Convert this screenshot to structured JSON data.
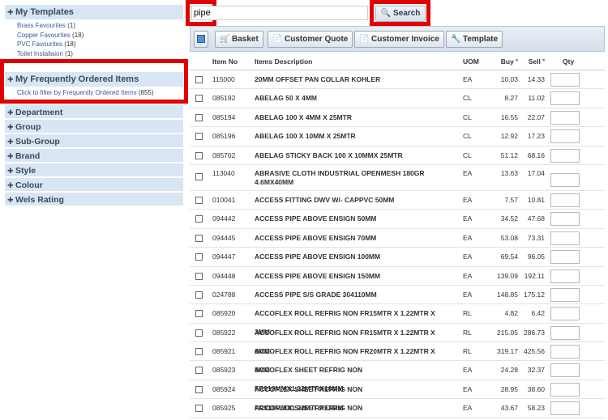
{
  "sidebar": {
    "templates": {
      "title": "My Templates",
      "links": [
        {
          "label": "Brass Favourites",
          "count": "(1)"
        },
        {
          "label": "Copper Favourites",
          "count": "(18)"
        },
        {
          "label": "PVC Favourites",
          "count": "(18)"
        },
        {
          "label": "Toilet Installaion",
          "count": "(1)"
        }
      ]
    },
    "frequent": {
      "title": "My Frequently Ordered Items",
      "link": "Click to filter by Frequently Ordered Items",
      "count": "(855)"
    },
    "filters": [
      "Department",
      "Group",
      "Sub-Group",
      "Brand",
      "Style",
      "Colour",
      "Wels Rating"
    ]
  },
  "search": {
    "value": "pipe",
    "button_label": "Search"
  },
  "toolbar": {
    "basket": "Basket",
    "customer_quote": "Customer Quote",
    "customer_invoice": "Customer Invoice",
    "template": "Template"
  },
  "table": {
    "headers": {
      "item_no": "Item No",
      "desc": "Items Description",
      "uom": "UOM",
      "buy": "Buy ˟",
      "sell": "Sell ˟",
      "qty": "Qty"
    },
    "rows": [
      {
        "item_no": "115000",
        "desc": "20MM OFFSET PAN COLLAR KOHLER",
        "uom": "EA",
        "buy": "10.03",
        "sell": "14.33"
      },
      {
        "item_no": "085192",
        "desc": "ABELAG 50 X 4MM",
        "uom": "CL",
        "buy": "8.27",
        "sell": "11.02"
      },
      {
        "item_no": "085194",
        "desc": "ABELAG 100 X 4MM X 25MTR",
        "uom": "CL",
        "buy": "16.55",
        "sell": "22.07"
      },
      {
        "item_no": "085196",
        "desc": "ABELAG 100 X 10MM X 25MTR",
        "uom": "CL",
        "buy": "12.92",
        "sell": "17.23"
      },
      {
        "item_no": "085702",
        "desc": "ABELAG STICKY BACK 100 X 10MMX 25MTR",
        "uom": "CL",
        "buy": "51.12",
        "sell": "68.16"
      },
      {
        "item_no": "113040",
        "desc": "ABRASIVE CLOTH INDUSTRIAL OPENMESH 180GR 4.6MX40MM",
        "uom": "EA",
        "buy": "13.63",
        "sell": "17.04"
      },
      {
        "item_no": "010041",
        "desc": "ACCESS FITTING DWV W/- CAPPVC 50MM",
        "uom": "EA",
        "buy": "7.57",
        "sell": "10.81"
      },
      {
        "item_no": "094442",
        "desc": "ACCESS PIPE ABOVE ENSIGN 50MM",
        "uom": "EA",
        "buy": "34.52",
        "sell": "47.68"
      },
      {
        "item_no": "094445",
        "desc": "ACCESS PIPE ABOVE ENSIGN 70MM",
        "uom": "EA",
        "buy": "53.08",
        "sell": "73.31"
      },
      {
        "item_no": "094447",
        "desc": "ACCESS PIPE ABOVE ENSIGN 100MM",
        "uom": "EA",
        "buy": "69.54",
        "sell": "96.05"
      },
      {
        "item_no": "094448",
        "desc": "ACCESS PIPE ABOVE ENSIGN 150MM",
        "uom": "EA",
        "buy": "139.09",
        "sell": "192.11"
      },
      {
        "item_no": "024788",
        "desc": "ACCESS PIPE S/S GRADE 304110MM",
        "uom": "EA",
        "buy": "148.85",
        "sell": "175.12"
      },
      {
        "item_no": "085920",
        "desc": "ACCOFLEX ROLL REFRIG NON FR15MTR X 1.22MTR X 3MM",
        "uom": "RL",
        "buy": "4.82",
        "sell": "6.42"
      },
      {
        "item_no": "085922",
        "desc": "ACCOFLEX ROLL REFRIG NON FR15MTR X 1.22MTR X 6MM",
        "uom": "RL",
        "buy": "215.05",
        "sell": "286.73"
      },
      {
        "item_no": "085921",
        "desc": "ACCOFLEX ROLL REFRIG NON FR20MTR X 1.22MTR X 5MM",
        "uom": "RL",
        "buy": "319.17",
        "sell": "425.56"
      },
      {
        "item_no": "085923",
        "desc": "ACCOFLEX SHEET REFRIG NON FR910MMX1.22MTRX10MM",
        "uom": "EA",
        "buy": "24.28",
        "sell": "32.37"
      },
      {
        "item_no": "085924",
        "desc": "ACCOFLEX SHEET REFRIG NON FR910MMX1.22MTRX13MM",
        "uom": "EA",
        "buy": "28.95",
        "sell": "38.60"
      },
      {
        "item_no": "085925",
        "desc": "ACCOFLEX SHEET REFRIG NON FR910MMX1.22MTRX19MM",
        "uom": "EA",
        "buy": "43.67",
        "sell": "58.23"
      }
    ]
  },
  "colors": {
    "highlight": "#e00000",
    "panel": "#d8e6f3",
    "link": "#3a5a9a"
  }
}
